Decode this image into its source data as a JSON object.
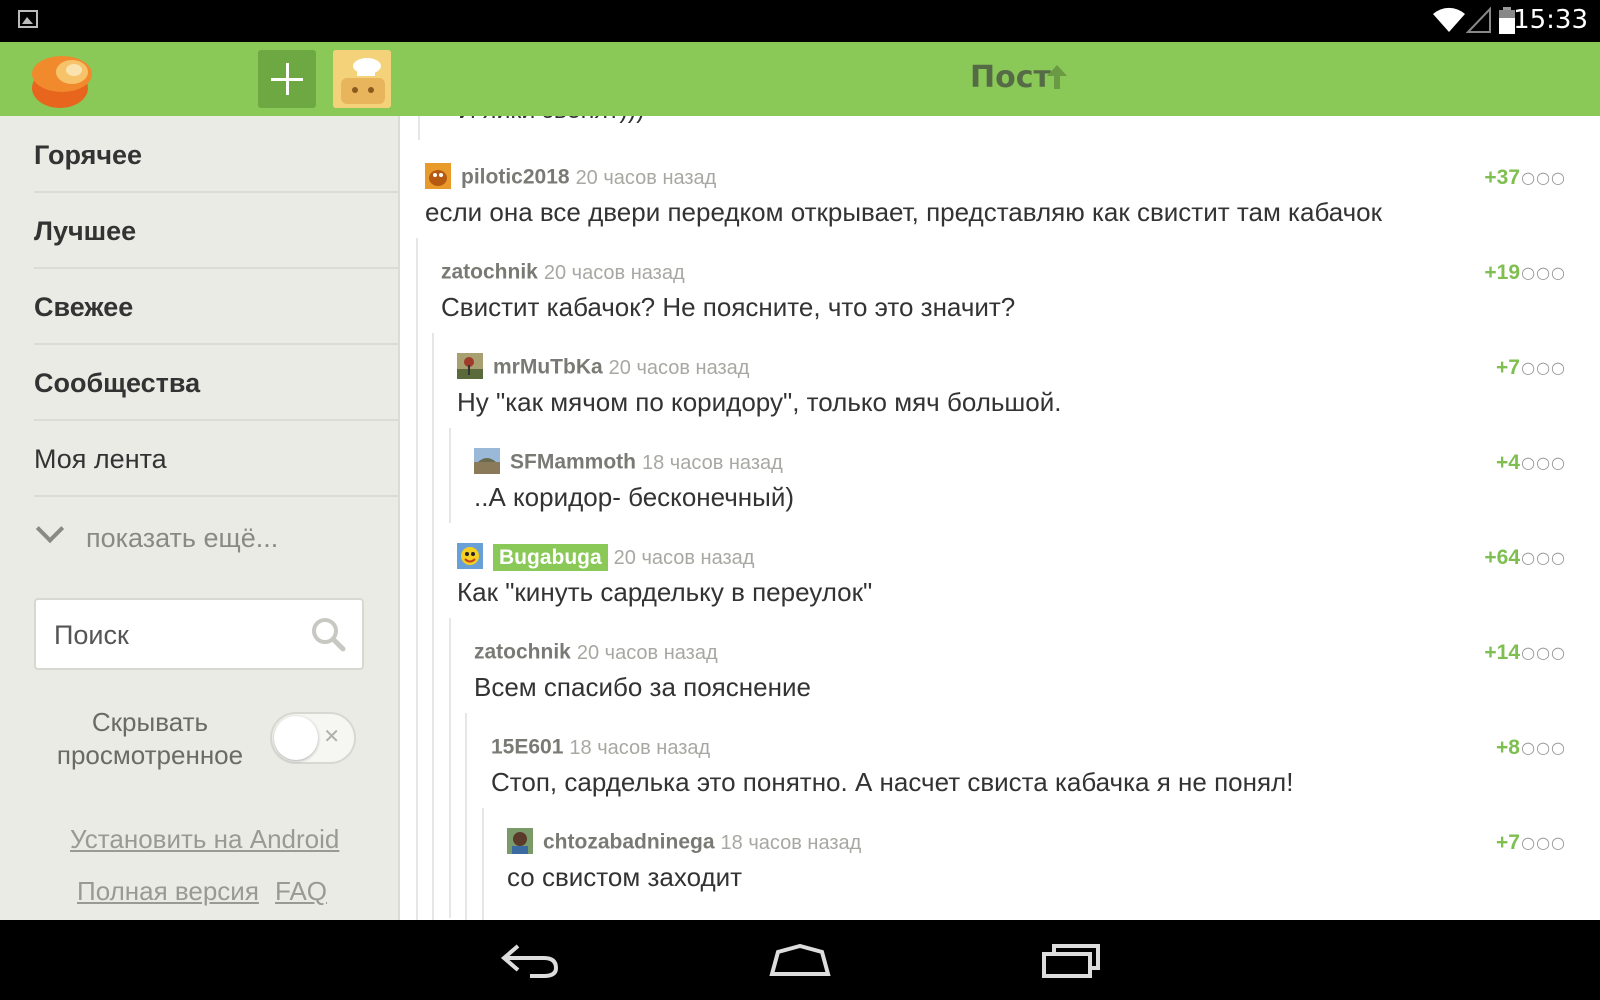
{
  "status_bar": {
    "time": "15:33",
    "icons": [
      "image-icon",
      "wifi-icon",
      "signal-icon",
      "battery-icon"
    ]
  },
  "app_bar": {
    "title": "Пост",
    "title_icon": "arrow-up-icon",
    "add_icon": "plus-icon",
    "accent": "#8ac858"
  },
  "sidebar": {
    "items": [
      {
        "label": "Горячее",
        "bold": true
      },
      {
        "label": "Лучшее",
        "bold": true
      },
      {
        "label": "Свежее",
        "bold": true
      },
      {
        "label": "Сообщества",
        "bold": true
      },
      {
        "label": "Моя лента",
        "bold": false
      }
    ],
    "show_more": "показать ещё...",
    "search": {
      "placeholder": "Поиск",
      "value": ""
    },
    "hide_viewed": {
      "label": "Скрывать просмотренное",
      "enabled": false
    },
    "links": {
      "install": "Установить на Android",
      "full_version": "Полная версия",
      "faq": "FAQ"
    }
  },
  "comments": {
    "cut_text": "И яйки звенят)))",
    "items": [
      {
        "user": "pilotic2018",
        "time": "20 часов назад",
        "rating": "+37",
        "text": "если она все двери передком открывает, представляю как свистит там кабачок",
        "avatar": true,
        "highlight": false
      },
      {
        "user": "zatochnik",
        "time": "20 часов назад",
        "rating": "+19",
        "text": "Свистит кабачок? Не поясните, что это значит?",
        "avatar": false,
        "highlight": false
      },
      {
        "user": "mrMuTbKa",
        "time": "20 часов назад",
        "rating": "+7",
        "text": "Ну \"как мячом по коридору\", только мяч большой.",
        "avatar": true,
        "highlight": false
      },
      {
        "user": "SFMammoth",
        "time": "18 часов назад",
        "rating": "+4",
        "text": "..А коридор- бесконечный)",
        "avatar": true,
        "highlight": false
      },
      {
        "user": "Bugabuga",
        "time": "20 часов назад",
        "rating": "+64",
        "text": "Как \"кинуть сардельку в переулок\"",
        "avatar": true,
        "highlight": true
      },
      {
        "user": "zatochnik",
        "time": "20 часов назад",
        "rating": "+14",
        "text": "Всем спасибо за пояснение",
        "avatar": false,
        "highlight": false
      },
      {
        "user": "15E601",
        "time": "18 часов назад",
        "rating": "+8",
        "text": "Стоп, сарделька это понятно. А насчет свиста кабачка я не понял!",
        "avatar": false,
        "highlight": false
      },
      {
        "user": "chtozabadninega",
        "time": "18 часов назад",
        "rating": "+7",
        "text": "со свистом заходит",
        "avatar": true,
        "highlight": false
      }
    ],
    "more_icon": "○○○"
  },
  "nav_bar": {
    "icons": [
      "back-icon",
      "home-icon",
      "recents-icon"
    ]
  }
}
